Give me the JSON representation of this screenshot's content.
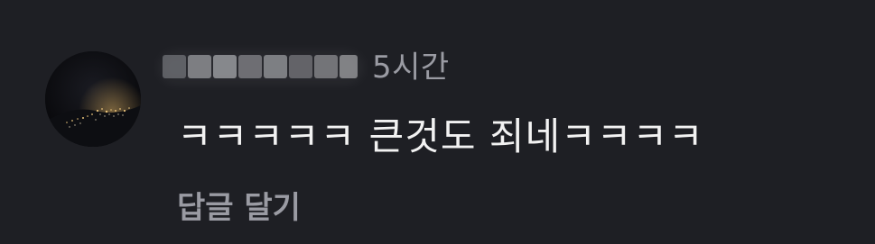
{
  "comment": {
    "time_ago": "5시간",
    "text": "ㅋㅋㅋㅋㅋ 큰것도 죄네ㅋㅋㅋㅋ",
    "reply_label": "답글 달기",
    "avatar_icon": "night-city-photo-avatar",
    "username_redacted": true
  },
  "colors": {
    "background": "#1e1f24",
    "primary_text": "#f2f2f2",
    "secondary_text": "#9a9ba3"
  }
}
